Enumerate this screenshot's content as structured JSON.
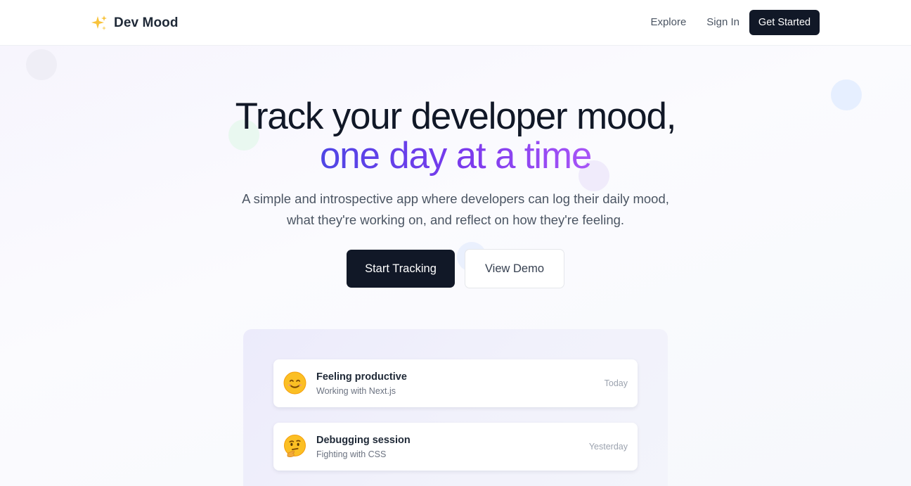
{
  "header": {
    "app_name": "Dev Mood",
    "logo_icon": "sparkles-icon",
    "nav": {
      "explore": "Explore",
      "sign_in": "Sign In",
      "get_started": "Get Started"
    }
  },
  "hero": {
    "title_line1": "Track your developer mood,",
    "title_line2": "one day at a time",
    "subtitle_line1": "A simple and introspective app where developers can log their daily mood,",
    "subtitle_line2": "what they're working on, and reflect on how they're feeling.",
    "primary_cta": "Start Tracking",
    "secondary_cta": "View Demo"
  },
  "preview": {
    "entries": [
      {
        "emoji": "smiling-face-icon",
        "title": "Feeling productive",
        "description": "Working with Next.js",
        "date": "Today"
      },
      {
        "emoji": "thinking-face-icon",
        "title": "Debugging session",
        "description": "Fighting with CSS",
        "date": "Yesterday"
      }
    ]
  },
  "colors": {
    "primary_dark": "#111827",
    "gradient_start": "#4f46e5",
    "gradient_end": "#a855f7",
    "text_muted": "#4b5563"
  }
}
